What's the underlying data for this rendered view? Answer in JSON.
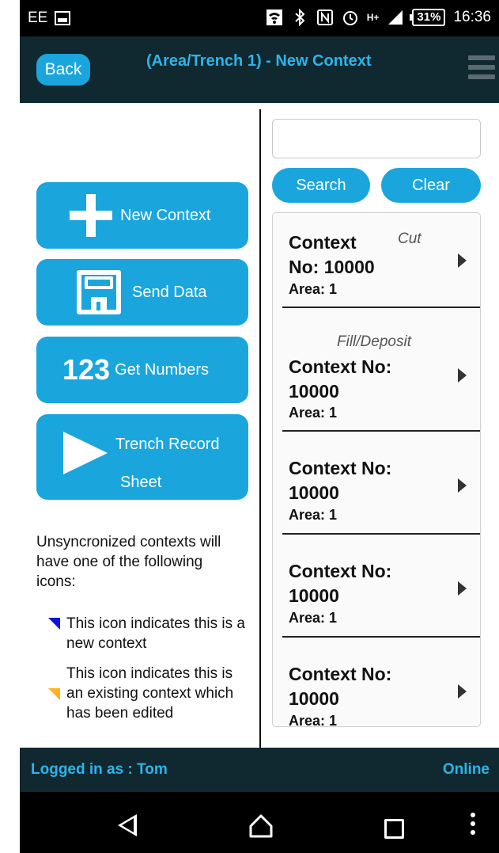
{
  "status_bar": {
    "carrier": "EE",
    "battery": "31%",
    "time": "16:36",
    "network": "H+"
  },
  "header": {
    "back_label": "Back",
    "title": "(Area/Trench 1) - New Context",
    "menu_icon": "hamburger-menu-icon"
  },
  "actions": {
    "new_context": "New Context",
    "send_data": "Send Data",
    "get_numbers_icon": "123",
    "get_numbers": "Get Numbers",
    "trench_line1": "Trench Record",
    "trench_line2": "Sheet"
  },
  "info": {
    "text": "Unsyncronized contexts will have one of the following icons:",
    "new_icon_text": "This icon indicates this is a new context",
    "edited_icon_text": "This icon indicates this is an existing context which has been edited",
    "new_icon_color": "#1010e0",
    "edited_icon_color": "#ffb21a"
  },
  "search": {
    "placeholder": "",
    "search_label": "Search",
    "clear_label": "Clear"
  },
  "contexts": [
    {
      "type": "Cut",
      "title_line1": "Context",
      "title_line2": "No: 10000",
      "area": "Area: 1"
    },
    {
      "type": "Fill/Deposit",
      "title_line1": "Context No:",
      "title_line2": "10000",
      "area": "Area: 1"
    },
    {
      "type": "",
      "title_line1": "Context No:",
      "title_line2": "10000",
      "area": "Area: 1"
    },
    {
      "type": "",
      "title_line1": "Context No:",
      "title_line2": "10000",
      "area": "Area: 1"
    },
    {
      "type": "",
      "title_line1": "Context No:",
      "title_line2": "10000",
      "area": "Area: 1"
    }
  ],
  "footer": {
    "logged_in": "Logged in as : Tom",
    "status": "Online"
  },
  "colors": {
    "accent": "#1aa6dc",
    "header_bg": "#102930",
    "title_text": "#2eb4ea"
  }
}
